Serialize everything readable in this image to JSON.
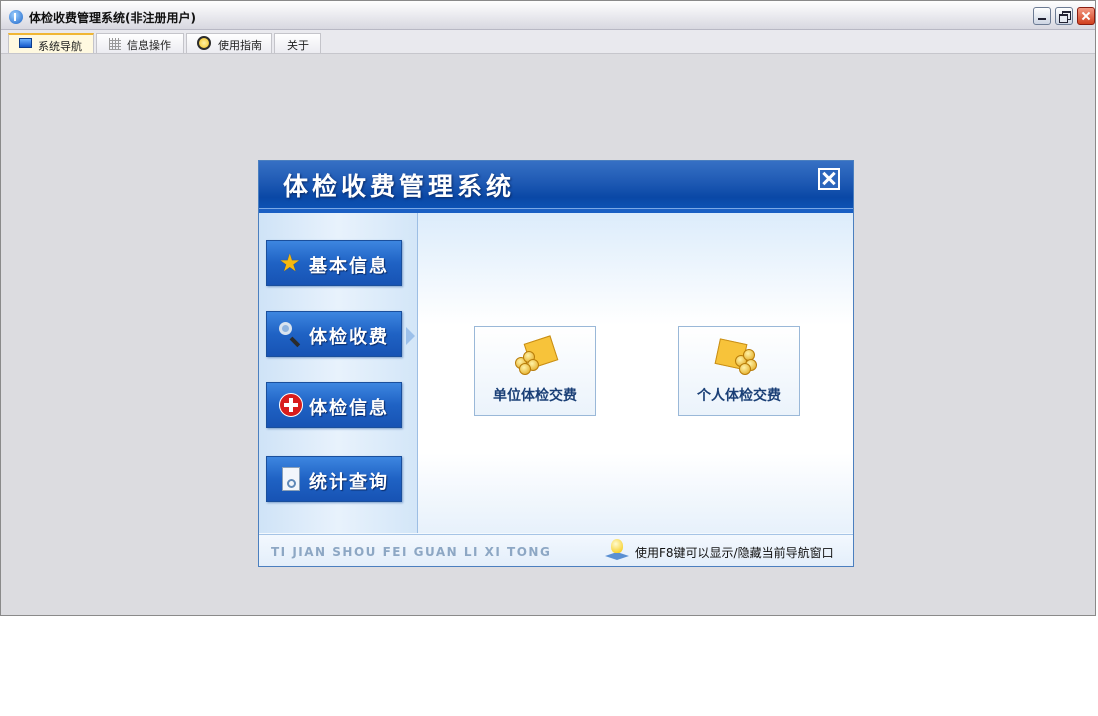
{
  "window": {
    "title": "体检收费管理系统(非注册用户)"
  },
  "tabs": [
    {
      "label": "系统导航",
      "icon": "monitor-icon",
      "active": true
    },
    {
      "label": "信息操作",
      "icon": "grid-icon",
      "active": false
    },
    {
      "label": "使用指南",
      "icon": "help-icon",
      "active": false
    },
    {
      "label": "关于",
      "icon": null,
      "active": false
    }
  ],
  "panel": {
    "title": "体检收费管理系统",
    "nav_items": [
      {
        "label": "基本信息",
        "icon": "star-icon"
      },
      {
        "label": "体检收费",
        "icon": "magnifier-icon",
        "selected": true
      },
      {
        "label": "体检信息",
        "icon": "red-cross-icon"
      },
      {
        "label": "统计查询",
        "icon": "document-icon"
      }
    ],
    "actions": [
      {
        "label": "单位体检交费",
        "icon": "group-payment-icon"
      },
      {
        "label": "个人体检交费",
        "icon": "personal-payment-icon"
      }
    ],
    "footer": {
      "pinyin": "TI JIAN SHOU FEI GUAN LI XI TONG",
      "tip": "使用F8键可以显示/隐藏当前导航窗口"
    }
  },
  "colors": {
    "header_blue": "#1f5ab4",
    "nav_button_blue": "#1f62c4",
    "desktop_gray": "#dcdce0",
    "card_text": "#1a3f76"
  }
}
